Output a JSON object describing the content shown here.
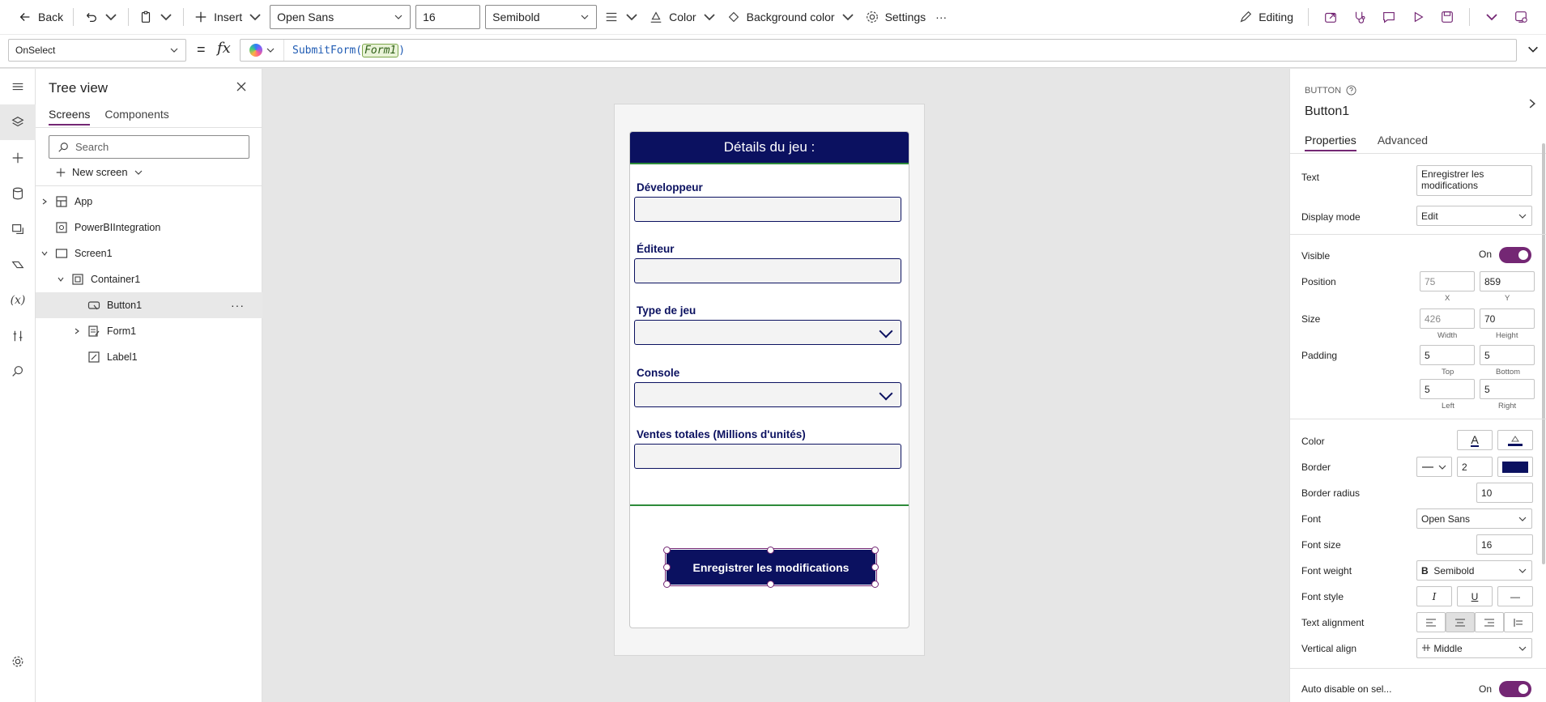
{
  "cmdbar": {
    "back_label": "Back",
    "insert_label": "Insert",
    "font_value": "Open Sans",
    "font_size_value": "16",
    "font_weight_value": "Semibold",
    "color_label": "Color",
    "bgcolor_label": "Background color",
    "settings_label": "Settings",
    "more_label": "···",
    "editing_label": "Editing"
  },
  "formula": {
    "property": "OnSelect",
    "equals": "=",
    "fx": "fx",
    "func": "SubmitForm",
    "open": "(",
    "arg": "Form1",
    "close": ")"
  },
  "tree": {
    "title": "Tree view",
    "tabs": [
      "Screens",
      "Components"
    ],
    "search_placeholder": "Search",
    "new_screen_label": "New screen",
    "nodes": [
      {
        "label": "App"
      },
      {
        "label": "PowerBIIntegration"
      },
      {
        "label": "Screen1"
      },
      {
        "label": "Container1"
      },
      {
        "label": "Button1"
      },
      {
        "label": "Form1"
      },
      {
        "label": "Label1"
      }
    ],
    "more_label": "···"
  },
  "canvas": {
    "header": "Détails du jeu :",
    "fields": [
      {
        "label": "Développeur"
      },
      {
        "label": "Éditeur"
      },
      {
        "label": "Type de jeu"
      },
      {
        "label": "Console"
      },
      {
        "label": "Ventes totales (Millions d'unités)"
      }
    ],
    "button_text": "Enregistrer les modifications"
  },
  "props": {
    "type": "BUTTON",
    "name": "Button1",
    "tabs": [
      "Properties",
      "Advanced"
    ],
    "text_label": "Text",
    "text_value": "Enregistrer les modifications",
    "display_mode_label": "Display mode",
    "display_mode_value": "Edit",
    "visible_label": "Visible",
    "on_label": "On",
    "position_label": "Position",
    "pos_x": "75",
    "pos_y": "859",
    "x_label": "X",
    "y_label": "Y",
    "size_label": "Size",
    "width": "426",
    "height": "70",
    "width_label": "Width",
    "height_label": "Height",
    "padding_label": "Padding",
    "pad_top": "5",
    "pad_bottom": "5",
    "pad_left": "5",
    "pad_right": "5",
    "top_label": "Top",
    "bottom_label": "Bottom",
    "left_label": "Left",
    "right_label": "Right",
    "color_label": "Color",
    "color_glyph": "A",
    "border_label": "Border",
    "border_width": "2",
    "border_radius_label": "Border radius",
    "border_radius": "10",
    "font_label": "Font",
    "font_value": "Open Sans",
    "font_size_label": "Font size",
    "font_size": "16",
    "font_weight_label": "Font weight",
    "font_weight_value": "Semibold",
    "font_weight_glyph": "B",
    "font_style_label": "Font style",
    "italic_glyph": "I",
    "underline_glyph": "U",
    "strike_glyph": "—",
    "text_alignment_label": "Text alignment",
    "vertical_align_label": "Vertical align",
    "vertical_align_value": "Middle",
    "auto_disable_label": "Auto disable on sel...",
    "auto_disable_on": "On"
  },
  "colors": {
    "accent": "#742774",
    "button_fill": "#0b1160",
    "form_border": "#2e8b3a"
  }
}
